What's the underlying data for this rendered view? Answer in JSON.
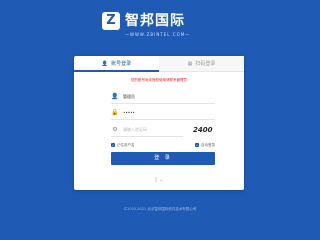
{
  "brand": {
    "mark": "Z",
    "name": "智邦国际",
    "tagline": "—WWW.ZBINTEL.COM—"
  },
  "login": {
    "tabs": [
      {
        "label": "账号登录"
      },
      {
        "label": "扫码登录"
      }
    ],
    "error": "您的账号尚未授权使用请联系管理员",
    "username": {
      "value": "管理员"
    },
    "password": {
      "value": "•••••"
    },
    "verify_code": {
      "placeholder": "请输入验证码"
    },
    "captcha": "2400",
    "remember": "记住用户名",
    "auto_login": "自动登录",
    "submit": "登 录"
  },
  "footer": {
    "copyright": "©2003-2021  北京智邦国际软件技术有限公司"
  }
}
